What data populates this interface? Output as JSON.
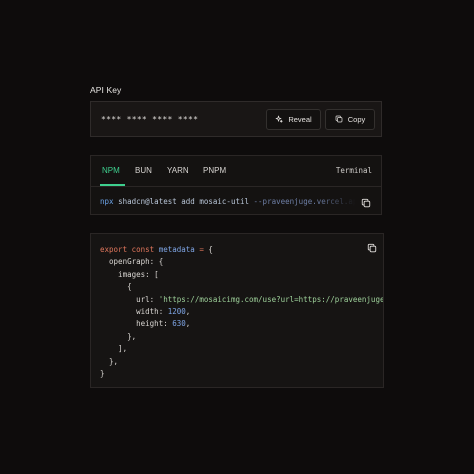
{
  "api_key": {
    "label": "API Key",
    "masked_value": "**** **** **** ****",
    "reveal_label": "Reveal",
    "copy_label": "Copy"
  },
  "install": {
    "tabs": [
      "NPM",
      "BUN",
      "YARN",
      "PNPM"
    ],
    "active_tab": "NPM",
    "terminal_label": "Terminal",
    "command": {
      "runner": "npx",
      "package": "shadcn@latest add mosaic-util",
      "flag": "--praveenjuge.vercel.app"
    }
  },
  "code": {
    "lines": [
      [
        {
          "t": "export const ",
          "c": "k"
        },
        {
          "t": "metadata",
          "c": "v"
        },
        {
          "t": " = ",
          "c": "k"
        },
        {
          "t": "{",
          "c": "p"
        }
      ],
      [
        {
          "t": "  openGraph: {",
          "c": "p"
        }
      ],
      [
        {
          "t": "    images: [",
          "c": "p"
        }
      ],
      [
        {
          "t": "      {",
          "c": "p"
        }
      ],
      [
        {
          "t": "        url: ",
          "c": "p"
        },
        {
          "t": "'https://mosaicimg.com/use?url=https://praveenjuge.com'",
          "c": "s"
        },
        {
          "t": ",",
          "c": "p"
        }
      ],
      [
        {
          "t": "        width: ",
          "c": "p"
        },
        {
          "t": "1200",
          "c": "n"
        },
        {
          "t": ",",
          "c": "p"
        }
      ],
      [
        {
          "t": "        height: ",
          "c": "p"
        },
        {
          "t": "630",
          "c": "n"
        },
        {
          "t": ",",
          "c": "p"
        }
      ],
      [
        {
          "t": "      },",
          "c": "p"
        }
      ],
      [
        {
          "t": "    ],",
          "c": "p"
        }
      ],
      [
        {
          "t": "  },",
          "c": "p"
        }
      ],
      [
        {
          "t": "}",
          "c": "p"
        }
      ]
    ]
  },
  "colors": {
    "background": "#0e0c0c",
    "accent_green": "#3ecf8e",
    "keyword": "#e0765c",
    "identifier": "#7fa6e6",
    "string": "#9ed19a"
  },
  "icons": [
    "sparkle-icon",
    "copy-icon"
  ]
}
